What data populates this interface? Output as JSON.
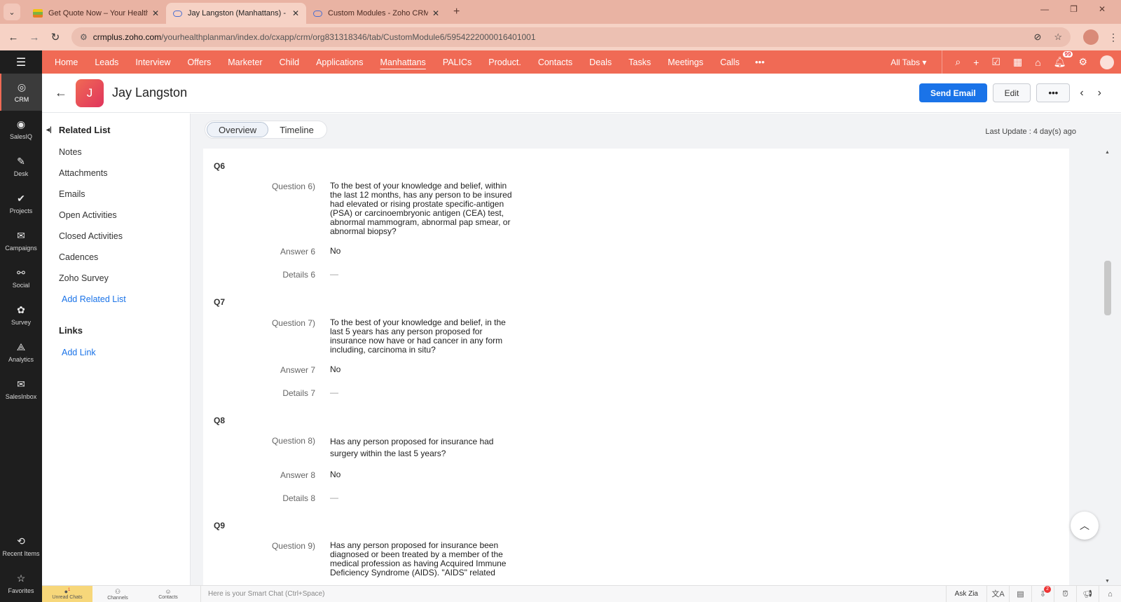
{
  "browser": {
    "tabs": [
      {
        "title": "Get Quote Now – Your Health P",
        "active": false
      },
      {
        "title": "Jay Langston (Manhattans) - Zo",
        "active": true
      },
      {
        "title": "Custom Modules - Zoho CRM",
        "active": false
      }
    ],
    "url_host": "crmplus.zoho.com",
    "url_path": "/yourhealthplanman/index.do/cxapp/crm/org831318346/tab/CustomModule6/5954222000016401001"
  },
  "rail": {
    "items": [
      {
        "label": "CRM",
        "icon": "crm-icon"
      },
      {
        "label": "SalesIQ",
        "icon": "salesiq-icon"
      },
      {
        "label": "Desk",
        "icon": "desk-icon"
      },
      {
        "label": "Projects",
        "icon": "projects-icon"
      },
      {
        "label": "Campaigns",
        "icon": "campaigns-icon"
      },
      {
        "label": "Social",
        "icon": "social-icon"
      },
      {
        "label": "Survey",
        "icon": "survey-icon"
      },
      {
        "label": "Analytics",
        "icon": "analytics-icon"
      },
      {
        "label": "SalesInbox",
        "icon": "salesinbox-icon"
      }
    ],
    "bottom": [
      {
        "label": "Recent Items",
        "icon": "history-icon"
      },
      {
        "label": "Favorites",
        "icon": "star-icon"
      }
    ]
  },
  "nav": {
    "tabs": [
      "Home",
      "Leads",
      "Interview",
      "Offers",
      "Marketer",
      "Child",
      "Applications",
      "Manhattans",
      "PALICs",
      "Product.",
      "Contacts",
      "Deals",
      "Tasks",
      "Meetings",
      "Calls"
    ],
    "active_tab": "Manhattans",
    "all_tabs": "All Tabs",
    "notification_count": "99"
  },
  "record": {
    "initial": "J",
    "name": "Jay Langston",
    "send_email": "Send Email",
    "edit": "Edit"
  },
  "related": {
    "title": "Related List",
    "items": [
      "Notes",
      "Attachments",
      "Emails",
      "Open Activities",
      "Closed Activities",
      "Cadences",
      "Zoho Survey"
    ],
    "add_related": "Add Related List",
    "links_title": "Links",
    "add_link": "Add Link"
  },
  "main": {
    "tabs": [
      "Overview",
      "Timeline"
    ],
    "active_tab": "Overview",
    "last_update": "Last Update : 4 day(s) ago"
  },
  "questions": [
    {
      "head": "Q6",
      "question_label": "Question 6)",
      "question_lines": [
        "To the best of your knowledge and belief, within",
        "the last 12 months, has any person to be insured",
        "had elevated or rising prostate specific-antigen",
        "(PSA) or carcinoembryonic antigen (CEA) test,",
        "abnormal mammogram, abnormal pap smear, or",
        "abnormal biopsy?"
      ],
      "answer_label": "Answer 6",
      "answer": "No",
      "details_label": "Details 6",
      "details": "—"
    },
    {
      "head": "Q7",
      "question_label": "Question 7)",
      "question_lines": [
        "To the best of your knowledge and belief, in the",
        "last 5 years has any person proposed for",
        "insurance now have or had cancer in any form",
        "including, carcinoma in situ?"
      ],
      "answer_label": "Answer 7",
      "answer": "No",
      "details_label": "Details 7",
      "details": "—"
    },
    {
      "head": "Q8",
      "question_label": "Question 8)",
      "question_lines": [
        "Has any person proposed for insurance had",
        "surgery within the last 5 years?"
      ],
      "answer_label": "Answer 8",
      "answer": "No",
      "details_label": "Details 8",
      "details": "—"
    },
    {
      "head": "Q9",
      "question_label": "Question 9)",
      "question_lines": [
        "Has any person proposed for insurance been",
        "diagnosed or been treated by a member of the",
        "medical profession as having Acquired Immune",
        "Deficiency Syndrome (AIDS). \"AIDS\" related"
      ]
    }
  ],
  "bottombar": {
    "unread_chats": "Unread Chats",
    "unread_count": "1",
    "channels": "Channels",
    "contacts": "Contacts",
    "smart_chat": "Here is your Smart Chat (Ctrl+Space)",
    "ask_zia": "Ask Zia",
    "downloads_count": "2"
  }
}
